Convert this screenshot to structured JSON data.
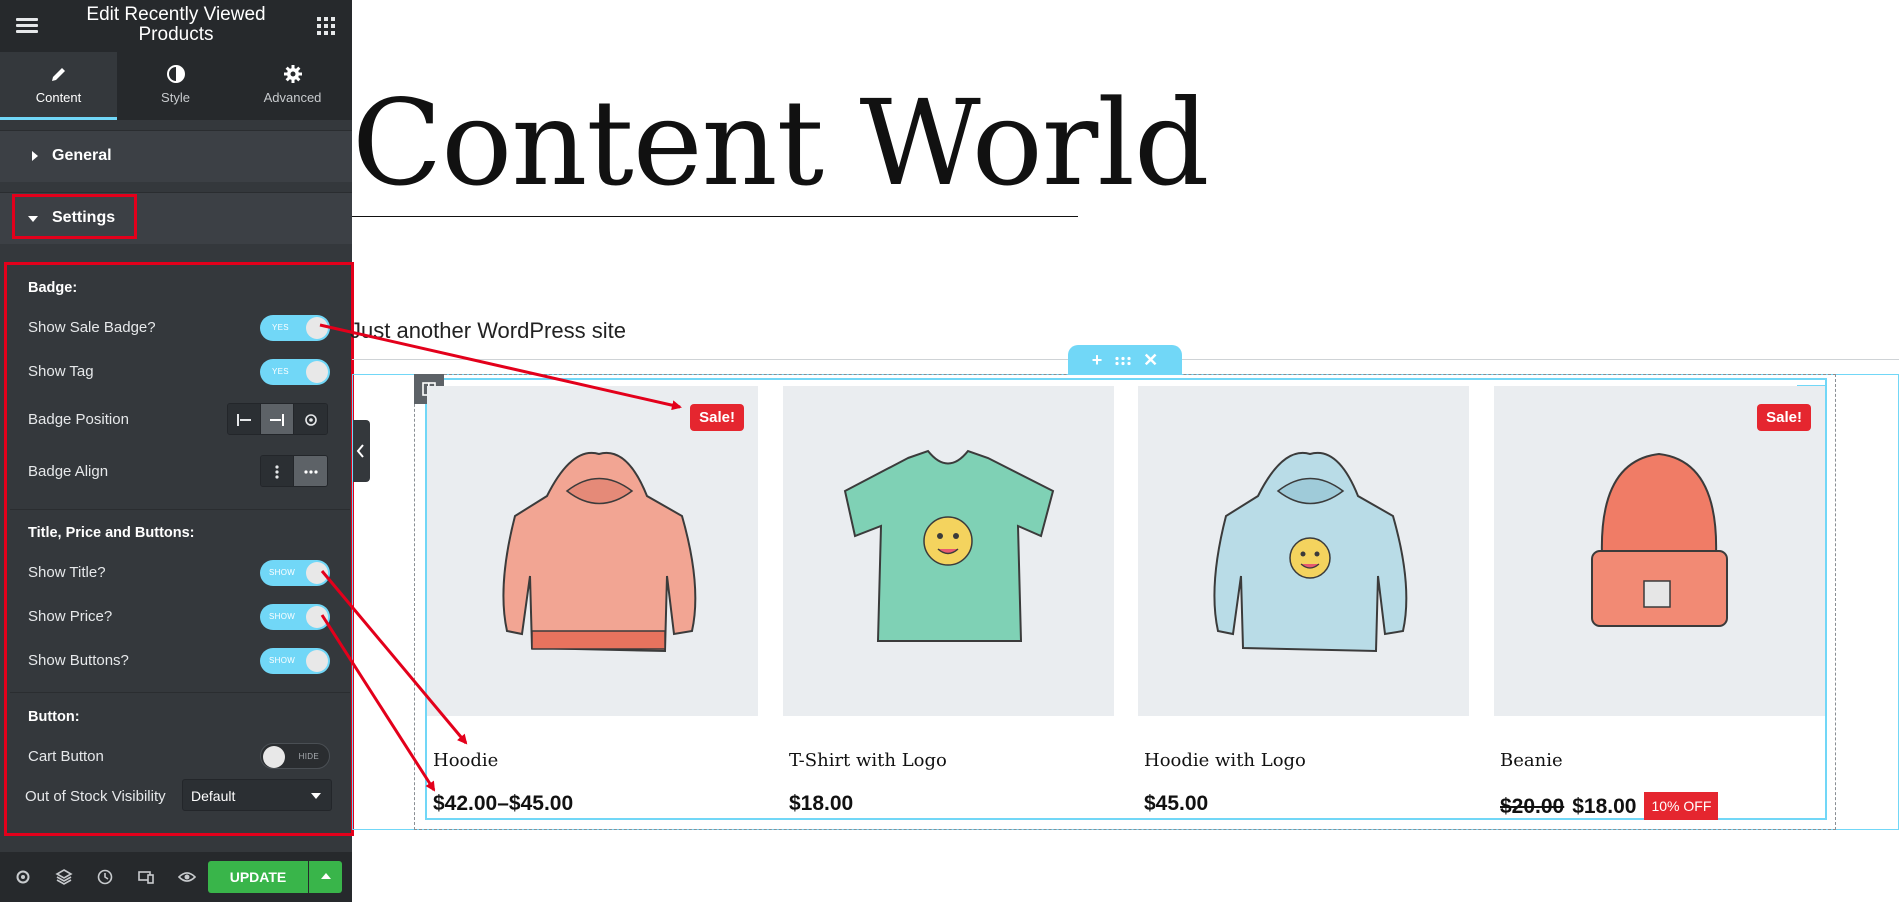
{
  "panel": {
    "title": "Edit Recently Viewed Products",
    "tabs": [
      {
        "label": "Content",
        "icon": "pencil-icon"
      },
      {
        "label": "Style",
        "icon": "contrast-icon"
      },
      {
        "label": "Advanced",
        "icon": "gear-icon"
      }
    ],
    "sections": {
      "general": "General",
      "settings": "Settings"
    },
    "badge": {
      "heading": "Badge:",
      "show_sale_badge": {
        "label": "Show Sale Badge?",
        "state": "YES"
      },
      "show_tag": {
        "label": "Show Tag",
        "state": "YES"
      },
      "position_label": "Badge Position",
      "align_label": "Badge Align"
    },
    "title_price_buttons": {
      "heading": "Title, Price and Buttons:",
      "show_title": {
        "label": "Show Title?",
        "state": "SHOW"
      },
      "show_price": {
        "label": "Show Price?",
        "state": "SHOW"
      },
      "show_buttons": {
        "label": "Show Buttons?",
        "state": "SHOW"
      }
    },
    "button": {
      "heading": "Button:",
      "cart_button": {
        "label": "Cart Button",
        "state": "HIDE"
      },
      "out_of_stock": {
        "label": "Out of Stock Visibility",
        "value": "Default"
      }
    },
    "footer": {
      "update_label": "UPDATE"
    }
  },
  "preview": {
    "site_title": "Content World",
    "tagline": "Just another WordPress site",
    "products": [
      {
        "title": "Hoodie",
        "price": "$42.00–$45.00",
        "badge": "Sale!"
      },
      {
        "title": "T-Shirt with Logo",
        "price": "$18.00"
      },
      {
        "title": "Hoodie with Logo",
        "price": "$45.00"
      },
      {
        "title": "Beanie",
        "old_price": "$20.00",
        "price": "$18.00",
        "badge": "Sale!",
        "discount": "10% OFF"
      }
    ]
  },
  "colors": {
    "accent": "#71d7f7",
    "highlight": "#e3001b",
    "sale": "#e5262f",
    "update": "#39b54a"
  }
}
